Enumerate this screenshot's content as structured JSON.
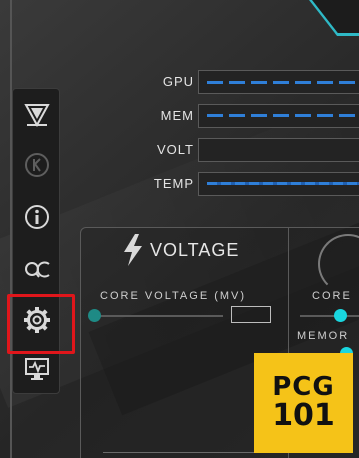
{
  "header": {
    "faint_title": ""
  },
  "sidebar": {
    "items": [
      {
        "name": "logo-app",
        "icon": "triangle-logo-icon",
        "active": false
      },
      {
        "name": "k-boost",
        "icon": "k-circle-icon",
        "active": false
      },
      {
        "name": "info",
        "icon": "info-icon",
        "active": false
      },
      {
        "name": "oc-scanner",
        "icon": "oc-icon",
        "active": false
      },
      {
        "name": "settings",
        "icon": "gear-icon",
        "active": true
      },
      {
        "name": "monitor",
        "icon": "monitor-icon",
        "active": false
      }
    ]
  },
  "monitor": {
    "rows": [
      {
        "label": "GPU"
      },
      {
        "label": "MEM"
      },
      {
        "label": "VOLT"
      },
      {
        "label": "TEMP"
      }
    ]
  },
  "voltage_panel": {
    "title": "VOLTAGE",
    "core_voltage_label": "CORE VOLTAGE (MV)",
    "core_voltage_value": ""
  },
  "clock_panel": {
    "core_label": "CORE",
    "memory_label": "MEMOR"
  },
  "logo": {
    "line1": "PCG",
    "line2": "101"
  },
  "colors": {
    "accent_cyan": "#19d6df",
    "bar_blue": "#2f7fd8",
    "highlight_red": "#e0161b",
    "logo_yellow": "#f5c318"
  }
}
